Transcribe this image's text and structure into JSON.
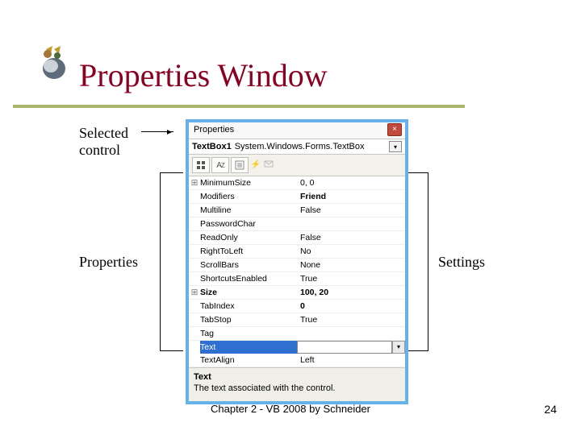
{
  "slide": {
    "title": "Properties Window",
    "callouts": {
      "selected": "Selected\ncontrol",
      "properties": "Properties",
      "settings": "Settings"
    },
    "footer": "Chapter 2 - VB 2008 by Schneider",
    "page_number": "24"
  },
  "propwin": {
    "title": "Properties",
    "object": {
      "bold": "TextBox1",
      "type": "System.Windows.Forms.TextBox"
    },
    "toolbar_icons": [
      "categorized-icon",
      "alphabetical-icon",
      "properties-page-icon",
      "events-icon",
      "messages-icon"
    ],
    "rows": [
      {
        "expander": "⊞",
        "name": "MinimumSize",
        "val": "0, 0"
      },
      {
        "expander": "",
        "name": "Modifiers",
        "val": "Friend",
        "bold": true
      },
      {
        "expander": "",
        "name": "Multiline",
        "val": "False"
      },
      {
        "expander": "",
        "name": "PasswordChar",
        "val": ""
      },
      {
        "expander": "",
        "name": "ReadOnly",
        "val": "False"
      },
      {
        "expander": "",
        "name": "RightToLeft",
        "val": "No"
      },
      {
        "expander": "",
        "name": "ScrollBars",
        "val": "None"
      },
      {
        "expander": "",
        "name": "ShortcutsEnabled",
        "val": "True"
      },
      {
        "expander": "⊞",
        "name": "Size",
        "val": "100, 20",
        "boldname": true,
        "bold": true
      },
      {
        "expander": "",
        "name": "TabIndex",
        "val": "0",
        "bold": true
      },
      {
        "expander": "",
        "name": "TabStop",
        "val": "True"
      },
      {
        "expander": "",
        "name": "Tag",
        "val": ""
      },
      {
        "expander": "",
        "name": "Text",
        "val": "",
        "selected": true
      },
      {
        "expander": "",
        "name": "TextAlign",
        "val": "Left"
      }
    ],
    "description": {
      "title": "Text",
      "body": "The text associated with the control."
    }
  }
}
